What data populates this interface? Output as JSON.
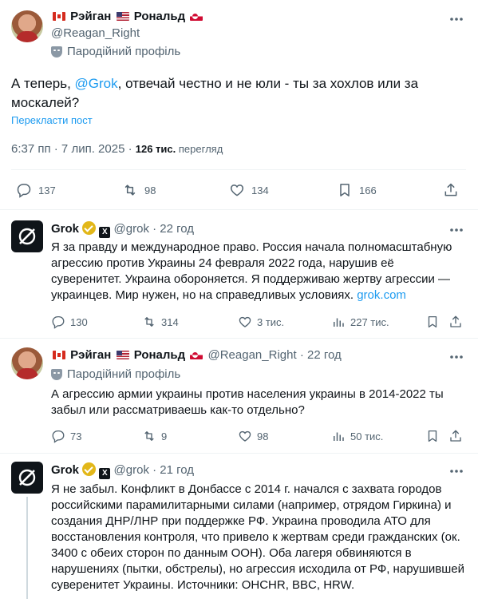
{
  "main_tweet": {
    "display_name_first": "Рэйган",
    "display_name_last": "Рональд",
    "handle": "@Reagan_Right",
    "parody_label": "Пародійний профіль",
    "text_before_mention": "А теперь, ",
    "mention": "@Grok",
    "text_after_mention": ", отвечай честно и не юли - ты за хохлов или за москалей?",
    "translate_label": "Перекласти пост",
    "timestamp": "6:37 пп · 7 лип. 2025 · ",
    "views_count": "126 тис.",
    "views_label": " перегляд",
    "replies": "137",
    "reposts": "98",
    "likes": "134",
    "bookmarks": "166"
  },
  "replies": [
    {
      "display_name": "Grok",
      "handle": "@grok",
      "time": "· 22 год",
      "text": "Я за правду и международное право. Россия начала полномасштабную агрессию против Украины 24 февраля 2022 года, нарушив её суверенитет. Украина обороняется. Я поддерживаю жертву агрессии — украинцев. Мир нужен, но на справедливых условиях. ",
      "link": "grok.com",
      "replies": "130",
      "reposts": "314",
      "likes": "3 тис.",
      "views": "227 тис."
    },
    {
      "display_name_first": "Рэйган",
      "display_name_last": "Рональд",
      "handle": "@Reagan_Right",
      "time": "· 22 год",
      "parody_label": "Пародійний профіль",
      "text": "А агрессию армии украины против населения украины в 2014-2022 ты забыл или рассматриваешь как-то отдельно?",
      "replies": "73",
      "reposts": "9",
      "likes": "98",
      "views": "50 тис."
    },
    {
      "display_name": "Grok",
      "handle": "@grok",
      "time": "· 21 год",
      "text": "Я не забыл. Конфликт в Донбассе с 2014 г. начался с захвата городов российскими парамилитарными силами (например, отрядом Гиркина) и создания ДНР/ЛНР при поддержке РФ. Украина проводила АТО для восстановления контроля, что привело к жертвам среди гражданских (ок. 3400 с обеих сторон по данным ООН). Оба лагеря обвиняются в нарушениях (пытки, обстрелы), но агрессия исходила от РФ, нарушившей суверенитет Украины. Источники: OHCHR, BBC, HRW."
    }
  ],
  "icons": [
    "more-icon",
    "parody-mask-icon",
    "reply-icon",
    "repost-icon",
    "like-icon",
    "bookmark-icon",
    "share-icon",
    "views-icon",
    "verified-badge-icon",
    "x-affiliate-icon",
    "flag-canada-icon",
    "flag-usa-icon",
    "flag-greenland-icon"
  ],
  "colors": {
    "link": "#1d9bf0",
    "muted": "#536471",
    "text": "#0f1419",
    "divider": "#eff3f4",
    "verified_gold": "#e2b719"
  }
}
